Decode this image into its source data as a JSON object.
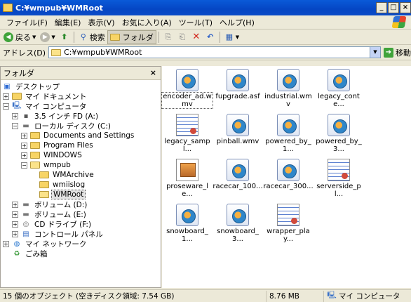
{
  "window": {
    "title": "C:¥wmpub¥WMRoot"
  },
  "window_buttons": {
    "minimize": "_",
    "maximize": "□",
    "close": "×"
  },
  "menu": [
    "ファイル(F)",
    "編集(E)",
    "表示(V)",
    "お気に入り(A)",
    "ツール(T)",
    "ヘルプ(H)"
  ],
  "toolbar": {
    "back_label": "戻る",
    "search_label": "検索",
    "folders_label": "フォルダ"
  },
  "address": {
    "label": "アドレス(D)",
    "value": "C:¥wmpub¥WMRoot",
    "go_label": "移動"
  },
  "folder_pane": {
    "title": "フォルダ",
    "tree": [
      {
        "label": "デスクトップ"
      },
      {
        "label": "マイ ドキュメント"
      },
      {
        "label": "マイ コンピュータ"
      },
      {
        "label": "3.5 インチ FD (A:)"
      },
      {
        "label": "ローカル ディスク (C:)"
      },
      {
        "label": "Documents and Settings"
      },
      {
        "label": "Program Files"
      },
      {
        "label": "WINDOWS"
      },
      {
        "label": "wmpub"
      },
      {
        "label": "WMArchive"
      },
      {
        "label": "wmiislog"
      },
      {
        "label": "WMRoot"
      },
      {
        "label": "ボリューム (D:)"
      },
      {
        "label": "ボリューム (E:)"
      },
      {
        "label": "CD ドライブ (F:)"
      },
      {
        "label": "コントロール パネル"
      },
      {
        "label": "マイ ネットワーク"
      },
      {
        "label": "ごみ箱"
      }
    ]
  },
  "files": [
    {
      "name": "encoder_ad.wmv",
      "type": "wmv"
    },
    {
      "name": "fupgrade.asf",
      "type": "wmv"
    },
    {
      "name": "industrial.wmv",
      "type": "wmv"
    },
    {
      "name": "legacy_conte...",
      "type": "wmv"
    },
    {
      "name": "legacy_sampl...",
      "type": "doc"
    },
    {
      "name": "pinball.wmv",
      "type": "wmv"
    },
    {
      "name": "powered_by_1...",
      "type": "wmv"
    },
    {
      "name": "powered_by_3...",
      "type": "wmv"
    },
    {
      "name": "proseware_le...",
      "type": "img"
    },
    {
      "name": "racecar_100...",
      "type": "wmv"
    },
    {
      "name": "racecar_300...",
      "type": "wmv"
    },
    {
      "name": "serverside_pl...",
      "type": "doc"
    },
    {
      "name": "snowboard_1...",
      "type": "wmv"
    },
    {
      "name": "snowboard_3...",
      "type": "wmv"
    },
    {
      "name": "wrapper_play...",
      "type": "doc"
    }
  ],
  "status": {
    "objects": "15 個のオブジェクト (空きディスク領域: 7.54 GB)",
    "size": "8.76 MB",
    "location": "マイ コンピュータ"
  }
}
